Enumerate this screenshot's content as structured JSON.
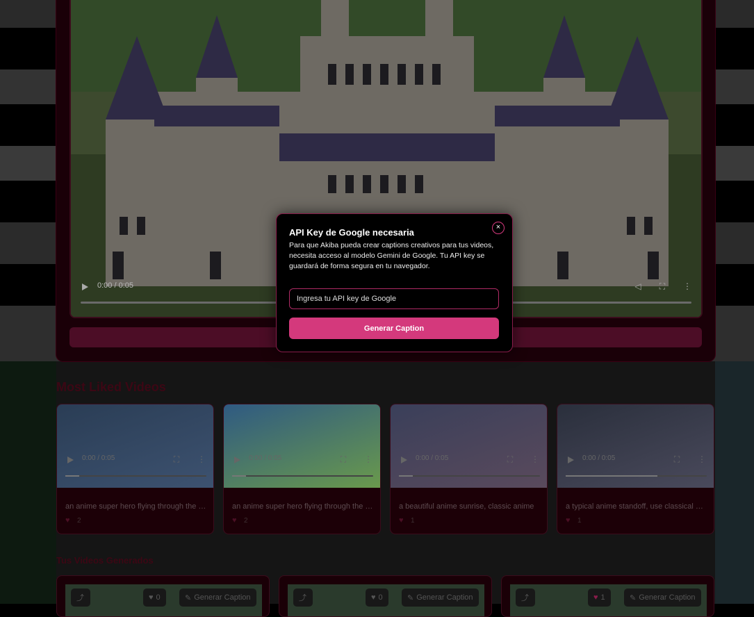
{
  "hero": {
    "time": "0:00 / 0:05"
  },
  "modal": {
    "title": "API Key de Google necesaria",
    "description": "Para que Akiba pueda crear captions creativos para tus videos, necesita acceso al modelo Gemini de Google. Tu API key se guardará de forma segura en tu navegador.",
    "input_placeholder": "Ingresa tu API key de Google",
    "button_label": "Generar Caption",
    "close_symbol": "×"
  },
  "most_liked": {
    "title": "Most Liked Videos",
    "videos": [
      {
        "time": "0:00 / 0:05",
        "title": "an anime super hero flying through the s...",
        "likes": "2",
        "progress": 0.1
      },
      {
        "time": "0:00 / 0:05",
        "title": "an anime super hero flying through the s...",
        "likes": "2",
        "progress": 0.1
      },
      {
        "time": "0:00 / 0:05",
        "title": "a beautiful anime sunrise, classic anime",
        "likes": "1",
        "progress": 0.1
      },
      {
        "time": "0:00 / 0:05",
        "title": "a typical anime standoff, use classical ani...",
        "likes": "1",
        "progress": 0.65
      }
    ]
  },
  "generated": {
    "title": "Tus Videos Generados",
    "videos": [
      {
        "likes": "0",
        "caption_label": "Generar Caption"
      },
      {
        "likes": "0",
        "caption_label": "Generar Caption"
      },
      {
        "likes": "1",
        "caption_label": "Generar Caption"
      }
    ]
  },
  "icons": {
    "play": "play-icon",
    "heart": "heart-icon",
    "share": "share-icon",
    "magic": "magic-wand-icon",
    "close": "close-icon"
  },
  "colors": {
    "accent": "#d4397c",
    "modal_border": "#8a1c4b",
    "card_bg": "#1c0007"
  }
}
